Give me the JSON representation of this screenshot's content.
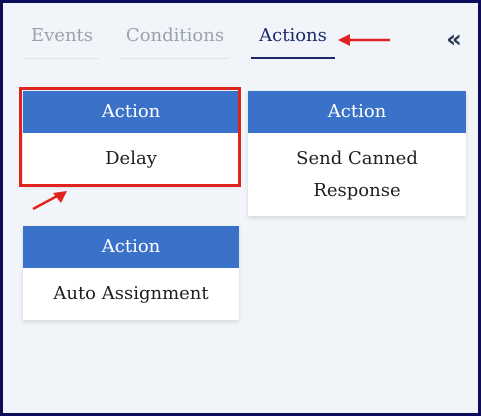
{
  "tabs": [
    {
      "label": "Events"
    },
    {
      "label": "Conditions"
    },
    {
      "label": "Actions",
      "active": true
    }
  ],
  "collapse_icon": "double-chevron-left-icon",
  "cards": [
    {
      "header": "Action",
      "body": "Delay"
    },
    {
      "header": "Action",
      "body": "Send Canned Response"
    },
    {
      "header": "Action",
      "body": "Auto Assignment"
    }
  ],
  "colors": {
    "card_header": "#3b72c9",
    "active_tab": "#1b2a6b",
    "annotation": "#e0231f",
    "frame": "#0d0d5a"
  }
}
